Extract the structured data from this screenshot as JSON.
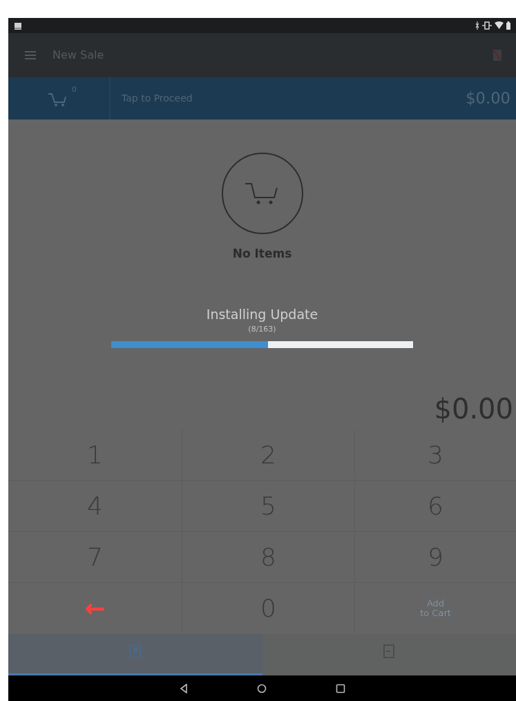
{
  "toolbar": {
    "title": "New Sale"
  },
  "cart_bar": {
    "badge": "0",
    "label": "Tap to Proceed",
    "total": "$0.00"
  },
  "empty_state": {
    "message": "No Items"
  },
  "update": {
    "title": "Installing Update",
    "progress": "(8/163)",
    "level": 0.52
  },
  "amount": "$0.00",
  "keypad": [
    {
      "kind": "digit",
      "label": "1"
    },
    {
      "kind": "digit",
      "label": "2"
    },
    {
      "kind": "digit",
      "label": "3"
    },
    {
      "kind": "digit",
      "label": "4"
    },
    {
      "kind": "digit",
      "label": "5"
    },
    {
      "kind": "digit",
      "label": "6"
    },
    {
      "kind": "digit",
      "label": "7"
    },
    {
      "kind": "digit",
      "label": "8"
    },
    {
      "kind": "digit",
      "label": "9"
    },
    {
      "kind": "backspace",
      "label": "←"
    },
    {
      "kind": "digit",
      "label": "0"
    },
    {
      "kind": "add",
      "lines": [
        "Add",
        "to Cart"
      ]
    }
  ],
  "bottom_tabs": [
    {
      "selected": true
    },
    {
      "selected": false
    }
  ]
}
